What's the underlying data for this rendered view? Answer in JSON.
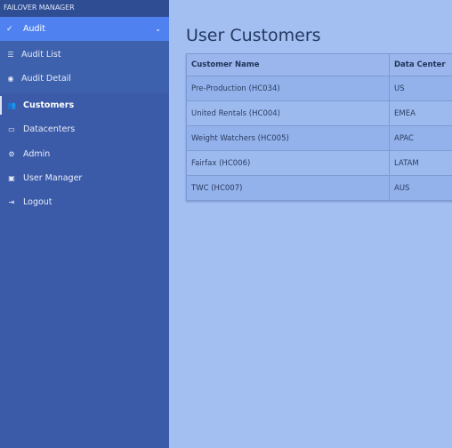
{
  "app": {
    "brand": "FAILOVER MANAGER"
  },
  "sidebar": {
    "section": {
      "label": "Audit",
      "icon": "check-icon",
      "chevron": "chevron-down-icon"
    },
    "sub_items": [
      {
        "label": "Audit List",
        "icon": "list-icon"
      },
      {
        "label": "Audit Detail",
        "icon": "eye-icon"
      }
    ],
    "items": [
      {
        "label": "Customers",
        "icon": "users-icon",
        "active": true
      },
      {
        "label": "Datacenters",
        "icon": "laptop-icon"
      },
      {
        "label": "Admin",
        "icon": "gear-icon"
      },
      {
        "label": "User Manager",
        "icon": "user-card-icon"
      },
      {
        "label": "Logout",
        "icon": "logout-icon"
      }
    ]
  },
  "main": {
    "title": "User Customers",
    "table": {
      "headers": [
        "Customer Name",
        "Data Center"
      ],
      "rows": [
        [
          "Pre-Production (HC034)",
          "US"
        ],
        [
          "United Rentals (HC004)",
          "EMEA"
        ],
        [
          "Weight Watchers (HC005)",
          "APAC"
        ],
        [
          "Fairfax (HC006)",
          "LATAM"
        ],
        [
          "TWC (HC007)",
          "AUS"
        ]
      ]
    }
  },
  "colors": {
    "sidebar_bg": "#3b5ba8",
    "section_active": "#4f82f0",
    "main_bg": "#a3bff2"
  }
}
